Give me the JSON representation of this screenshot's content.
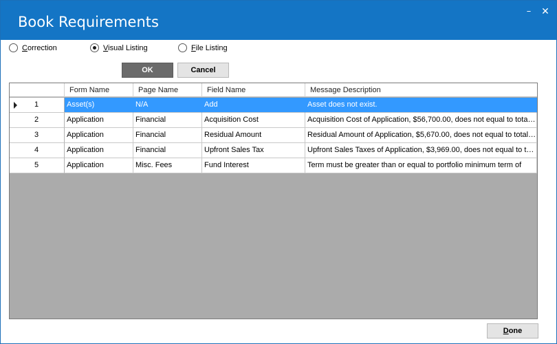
{
  "window": {
    "title": "Book Requirements",
    "minimize_glyph": "–",
    "close_glyph": "✕"
  },
  "options": [
    {
      "key": "C",
      "rest": "orrection",
      "checked": false
    },
    {
      "key": "V",
      "rest": "isual Listing",
      "checked": true
    },
    {
      "key": "F",
      "rest": "ile Listing",
      "checked": false
    }
  ],
  "buttons": {
    "ok": "OK",
    "cancel": "Cancel",
    "done_key": "D",
    "done_rest": "one"
  },
  "grid": {
    "columns": [
      "Form Name",
      "Page Name",
      "Field Name",
      "Message Description"
    ],
    "rows": [
      {
        "num": "1",
        "form": "Asset(s)",
        "page": "N/A",
        "field": "Add",
        "message": "Asset does not exist.",
        "selected": true
      },
      {
        "num": "2",
        "form": "Application",
        "page": "Financial",
        "field": "Acquisition Cost",
        "message": "Acquisition Cost of Application, $56,700.00, does not equal to total ...",
        "selected": false
      },
      {
        "num": "3",
        "form": "Application",
        "page": "Financial",
        "field": "Residual Amount",
        "message": "Residual Amount of Application, $5,670.00, does not equal to total o...",
        "selected": false
      },
      {
        "num": "4",
        "form": "Application",
        "page": "Financial",
        "field": "Upfront Sales Tax",
        "message": "Upfront Sales Taxes  of Application, $3,969.00, does not equal to to...",
        "selected": false
      },
      {
        "num": "5",
        "form": "Application",
        "page": "Misc. Fees",
        "field": "Fund Interest",
        "message": "Term must be greater than or equal to portfolio minimum term of",
        "selected": false
      }
    ]
  }
}
